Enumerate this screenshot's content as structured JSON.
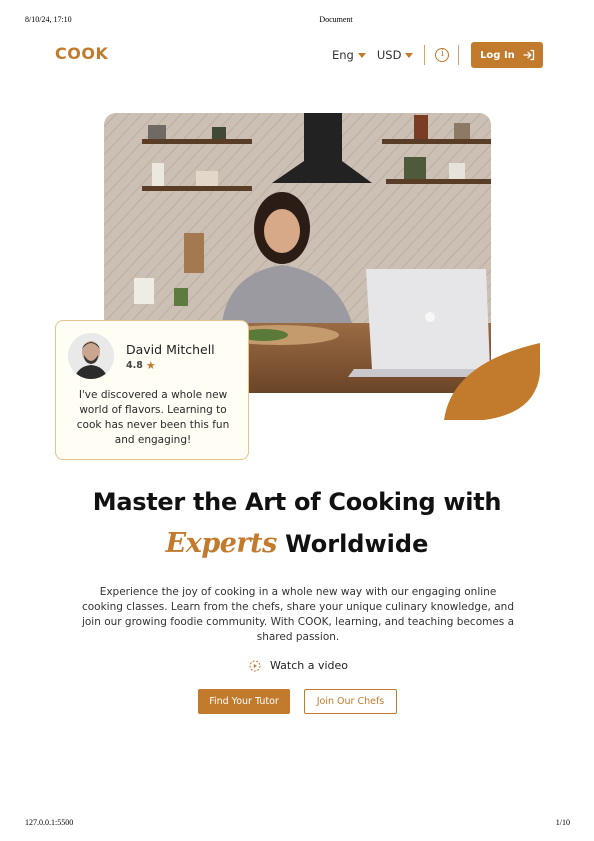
{
  "print_header": {
    "datetime": "8/10/24, 17:10",
    "title": "Document"
  },
  "print_footer": {
    "url": "127.0.0.1:5500",
    "page": "1/10"
  },
  "brand": {
    "logo": "COOK",
    "accent": "#c27a2c"
  },
  "nav": {
    "language": "Eng",
    "currency": "USD",
    "info_icon": "info-icon",
    "login_label": "Log In",
    "login_icon": "login-arrow-icon"
  },
  "review": {
    "name": "David Mitchell",
    "rating": "4.8",
    "text": "I've discovered a whole new world of flavors. Learning to cook has never been this fun and engaging!"
  },
  "hero": {
    "headline_line1": "Master the Art of Cooking with",
    "headline_script": "Experts",
    "headline_rest": "Worldwide",
    "description": "Experience the joy of cooking in a whole new way with our engaging online cooking classes. Learn from the chefs, share your unique culinary knowledge, and join our growing foodie community. With COOK, learning, and teaching becomes a shared passion.",
    "watch_label": "Watch a video",
    "primary_cta": "Find Your Tutor",
    "secondary_cta": "Join Our Chefs"
  }
}
